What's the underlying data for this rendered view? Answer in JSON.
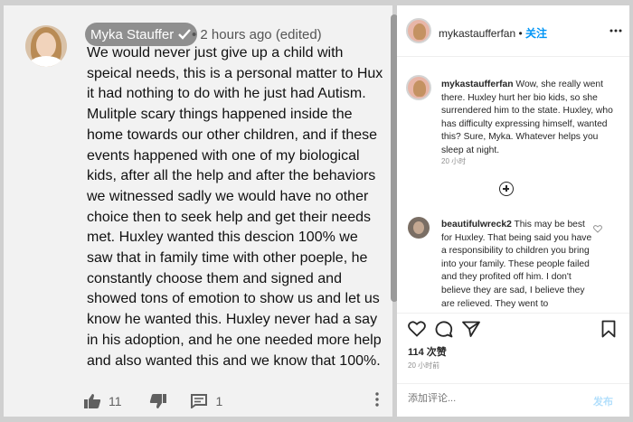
{
  "youtube_comment": {
    "author": "Myka Stauffer",
    "meta": "• 2 hours ago (edited)",
    "text": "We would never just give up a child with\nspeical needs, this is a personal matter to Hux\nit had nothing to do with he just had Autism.\nMulitple scary things happened inside the\nhome towards our other children, and if these\nevents happened with one of my biological\nkids, after all the help and after the behaviors\nwe witnessed sadly we would have no other\nchoice then to seek help and get their needs\nmet. Huxley wanted this descion 100% we\nsaw that in family time with other poeple, he\nconstantly choose them and signed and\nshowed tons of emotion to show us and let us\nknow he wanted this. Huxley never had a say\nin his adoption, and he one needed more help\nand also wanted this and we know that 100%.",
    "like_count": "11",
    "reply_count": "1",
    "icons": [
      "thumbs-up-icon",
      "thumbs-down-icon",
      "reply-icon",
      "more-vertical-icon",
      "verified-check-icon"
    ]
  },
  "instagram": {
    "username": "mykastaufferfan",
    "separator": " • ",
    "follow_label": "关注",
    "caption_user": "mykastaufferfan",
    "caption_text": " Wow, she really went there. Huxley hurt her bio kids, so she surrendered him to the state. Huxley, who has difficulty expressing himself, wanted this? Sure, Myka. Whatever helps you sleep at night.",
    "caption_time": "20 小时",
    "reply_user": "beautifulwreck2",
    "reply_text": " This may be best for Huxley. That being said you have a responsibility to children you bring into your family. These people failed and they profited off him. I don't believe they are sad, I believe they are relieved. They went to",
    "likes": "114 次赞",
    "date": "20 小时前",
    "comment_placeholder": "添加评论...",
    "post_label": "发布",
    "colors": {
      "link_blue": "#0095f6",
      "post_disabled": "#b2dffc"
    },
    "icons": [
      "heart-icon",
      "comment-icon",
      "share-icon",
      "bookmark-icon",
      "add-circle-icon",
      "more-horizontal-icon"
    ]
  }
}
